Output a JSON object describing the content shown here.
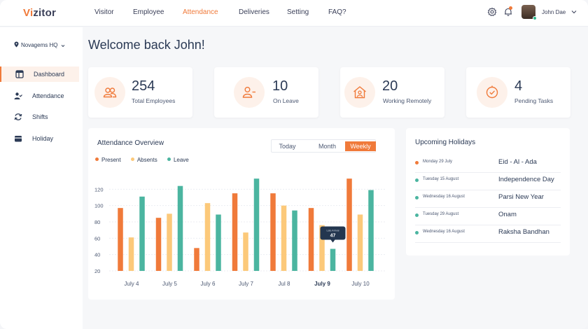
{
  "app": {
    "logo": {
      "v": "V",
      "i": "i",
      "rest": "zitor"
    },
    "nav": [
      "Visitor",
      "Employee",
      "Attendance",
      "Deliveries",
      "Setting",
      "FAQ?"
    ],
    "nav_active": "Attendance",
    "user": {
      "name": "John Dae"
    }
  },
  "sidebar": {
    "location": "Novagems HQ",
    "items": [
      {
        "label": "Dashboard",
        "icon": "dashboard-icon",
        "active": true
      },
      {
        "label": "Attendance",
        "icon": "user-check-icon",
        "active": false
      },
      {
        "label": "Shifts",
        "icon": "refresh-icon",
        "active": false
      },
      {
        "label": "Holiday",
        "icon": "wallet-icon",
        "active": false
      }
    ]
  },
  "main": {
    "welcome": "Welcome back John!",
    "stats": [
      {
        "value": "254",
        "label": "Total Employees",
        "icon": "users-icon"
      },
      {
        "value": "10",
        "label": "On Leave",
        "icon": "user-minus-icon"
      },
      {
        "value": "20",
        "label": "Working Remotely",
        "icon": "home-user-icon"
      },
      {
        "value": "4",
        "label": "Pending Tasks",
        "icon": "clock-icon"
      }
    ]
  },
  "attendance": {
    "title": "Attendance Overview",
    "tabs": [
      "Today",
      "Month",
      "Weekly"
    ],
    "active_tab": "Weekly",
    "tooltip": {
      "label": "Late Arrival",
      "value": "47"
    }
  },
  "holidays": {
    "title": "Upcoming Holidays",
    "items": [
      {
        "date": "Monday 29 July",
        "name": "Eid - Al - Ada",
        "color": "#f07a3a"
      },
      {
        "date": "Tuesday 15 August",
        "name": "Independence Day",
        "color": "#4bb5a0"
      },
      {
        "date": "Wednesday 16 August",
        "name": "Parsi New Year",
        "color": "#4bb5a0"
      },
      {
        "date": "Tuesday 29 August",
        "name": "Onam",
        "color": "#4bb5a0"
      },
      {
        "date": "Wednesday 16 August",
        "name": "Raksha Bandhan",
        "color": "#4bb5a0"
      }
    ]
  },
  "colors": {
    "accent": "#f07a3a",
    "present": "#f07a3a",
    "absents": "#fcc97a",
    "leave": "#4bb5a0"
  },
  "chart_data": {
    "type": "bar",
    "categories": [
      "July 4",
      "July 5",
      "July 6",
      "July 7",
      "Jul 8",
      "July 9",
      "July 10"
    ],
    "series": [
      {
        "name": "Present",
        "values": [
          97,
          85,
          48,
          115,
          115,
          97,
          133
        ]
      },
      {
        "name": "Absents",
        "values": [
          61,
          90,
          103,
          67,
          100,
          76,
          89
        ]
      },
      {
        "name": "Leave",
        "values": [
          111,
          124,
          89,
          133,
          94,
          47,
          119
        ]
      }
    ],
    "yticks": [
      20,
      40,
      60,
      80,
      100,
      120
    ],
    "ylim": [
      20,
      140
    ],
    "highlight_category": "July 9",
    "grid": true,
    "legend": "top-left",
    "title": "Attendance Overview"
  }
}
